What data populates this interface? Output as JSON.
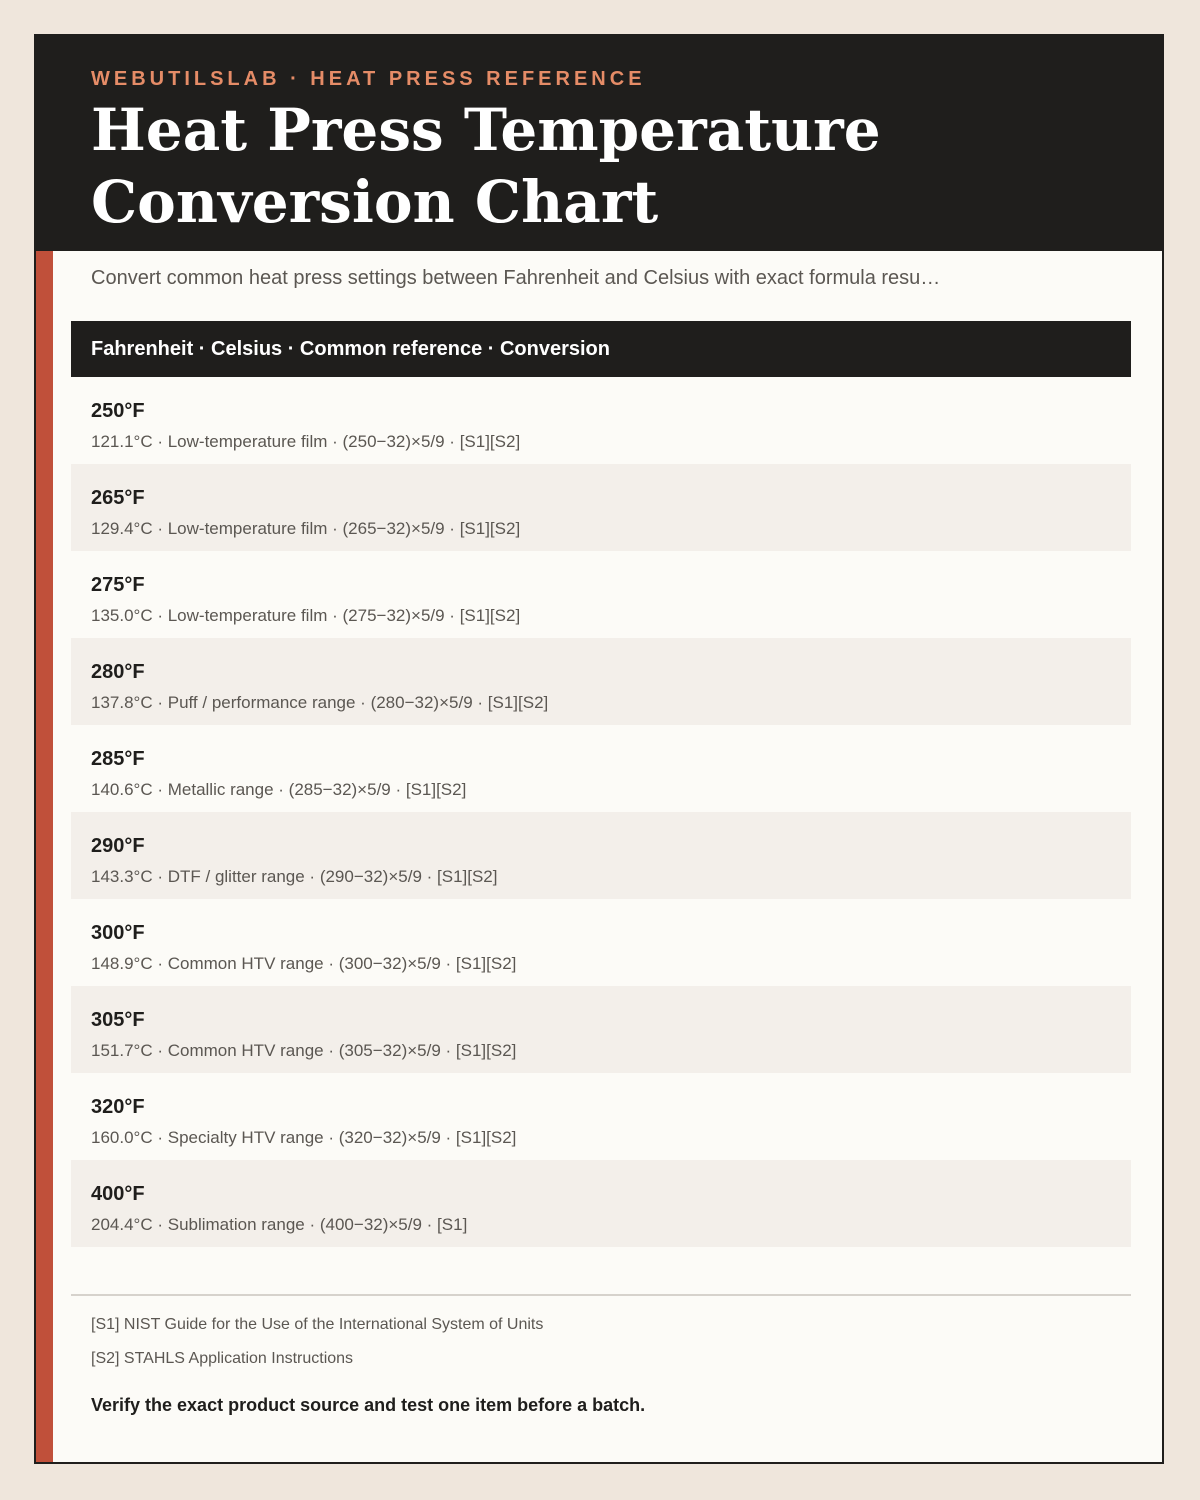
{
  "header": {
    "eyebrow": "WEBUTILSLAB · HEAT PRESS REFERENCE",
    "title": "Heat Press Temperature Conversion Chart"
  },
  "subtitle": "Convert common heat press settings between Fahrenheit and Celsius with exact formula resu…",
  "table": {
    "header": "Fahrenheit · Celsius · Common reference · Conversion",
    "rows": [
      {
        "fahrenheit": "250°F",
        "detail": "121.1°C · Low-temperature film · (250−32)×5/9 · [S1][S2]"
      },
      {
        "fahrenheit": "265°F",
        "detail": "129.4°C · Low-temperature film · (265−32)×5/9 · [S1][S2]"
      },
      {
        "fahrenheit": "275°F",
        "detail": "135.0°C · Low-temperature film · (275−32)×5/9 · [S1][S2]"
      },
      {
        "fahrenheit": "280°F",
        "detail": "137.8°C · Puff / performance range · (280−32)×5/9 · [S1][S2]"
      },
      {
        "fahrenheit": "285°F",
        "detail": "140.6°C · Metallic range · (285−32)×5/9 · [S1][S2]"
      },
      {
        "fahrenheit": "290°F",
        "detail": "143.3°C · DTF / glitter range · (290−32)×5/9 · [S1][S2]"
      },
      {
        "fahrenheit": "300°F",
        "detail": "148.9°C · Common HTV range · (300−32)×5/9 · [S1][S2]"
      },
      {
        "fahrenheit": "305°F",
        "detail": "151.7°C · Common HTV range · (305−32)×5/9 · [S1][S2]"
      },
      {
        "fahrenheit": "320°F",
        "detail": "160.0°C · Specialty HTV range · (320−32)×5/9 · [S1][S2]"
      },
      {
        "fahrenheit": "400°F",
        "detail": "204.4°C · Sublimation range · (400−32)×5/9 · [S1]"
      }
    ]
  },
  "sources": [
    "[S1] NIST Guide for the Use of the International System of Units",
    "[S2] STAHLS Application Instructions"
  ],
  "note": "Verify the exact product source and test one item before a batch.",
  "colors": {
    "background": "#efe6dc",
    "header_bg": "#1f1e1c",
    "eyebrow": "#e58c67",
    "accent": "#c0503a",
    "row_alt": "#f3efea"
  }
}
